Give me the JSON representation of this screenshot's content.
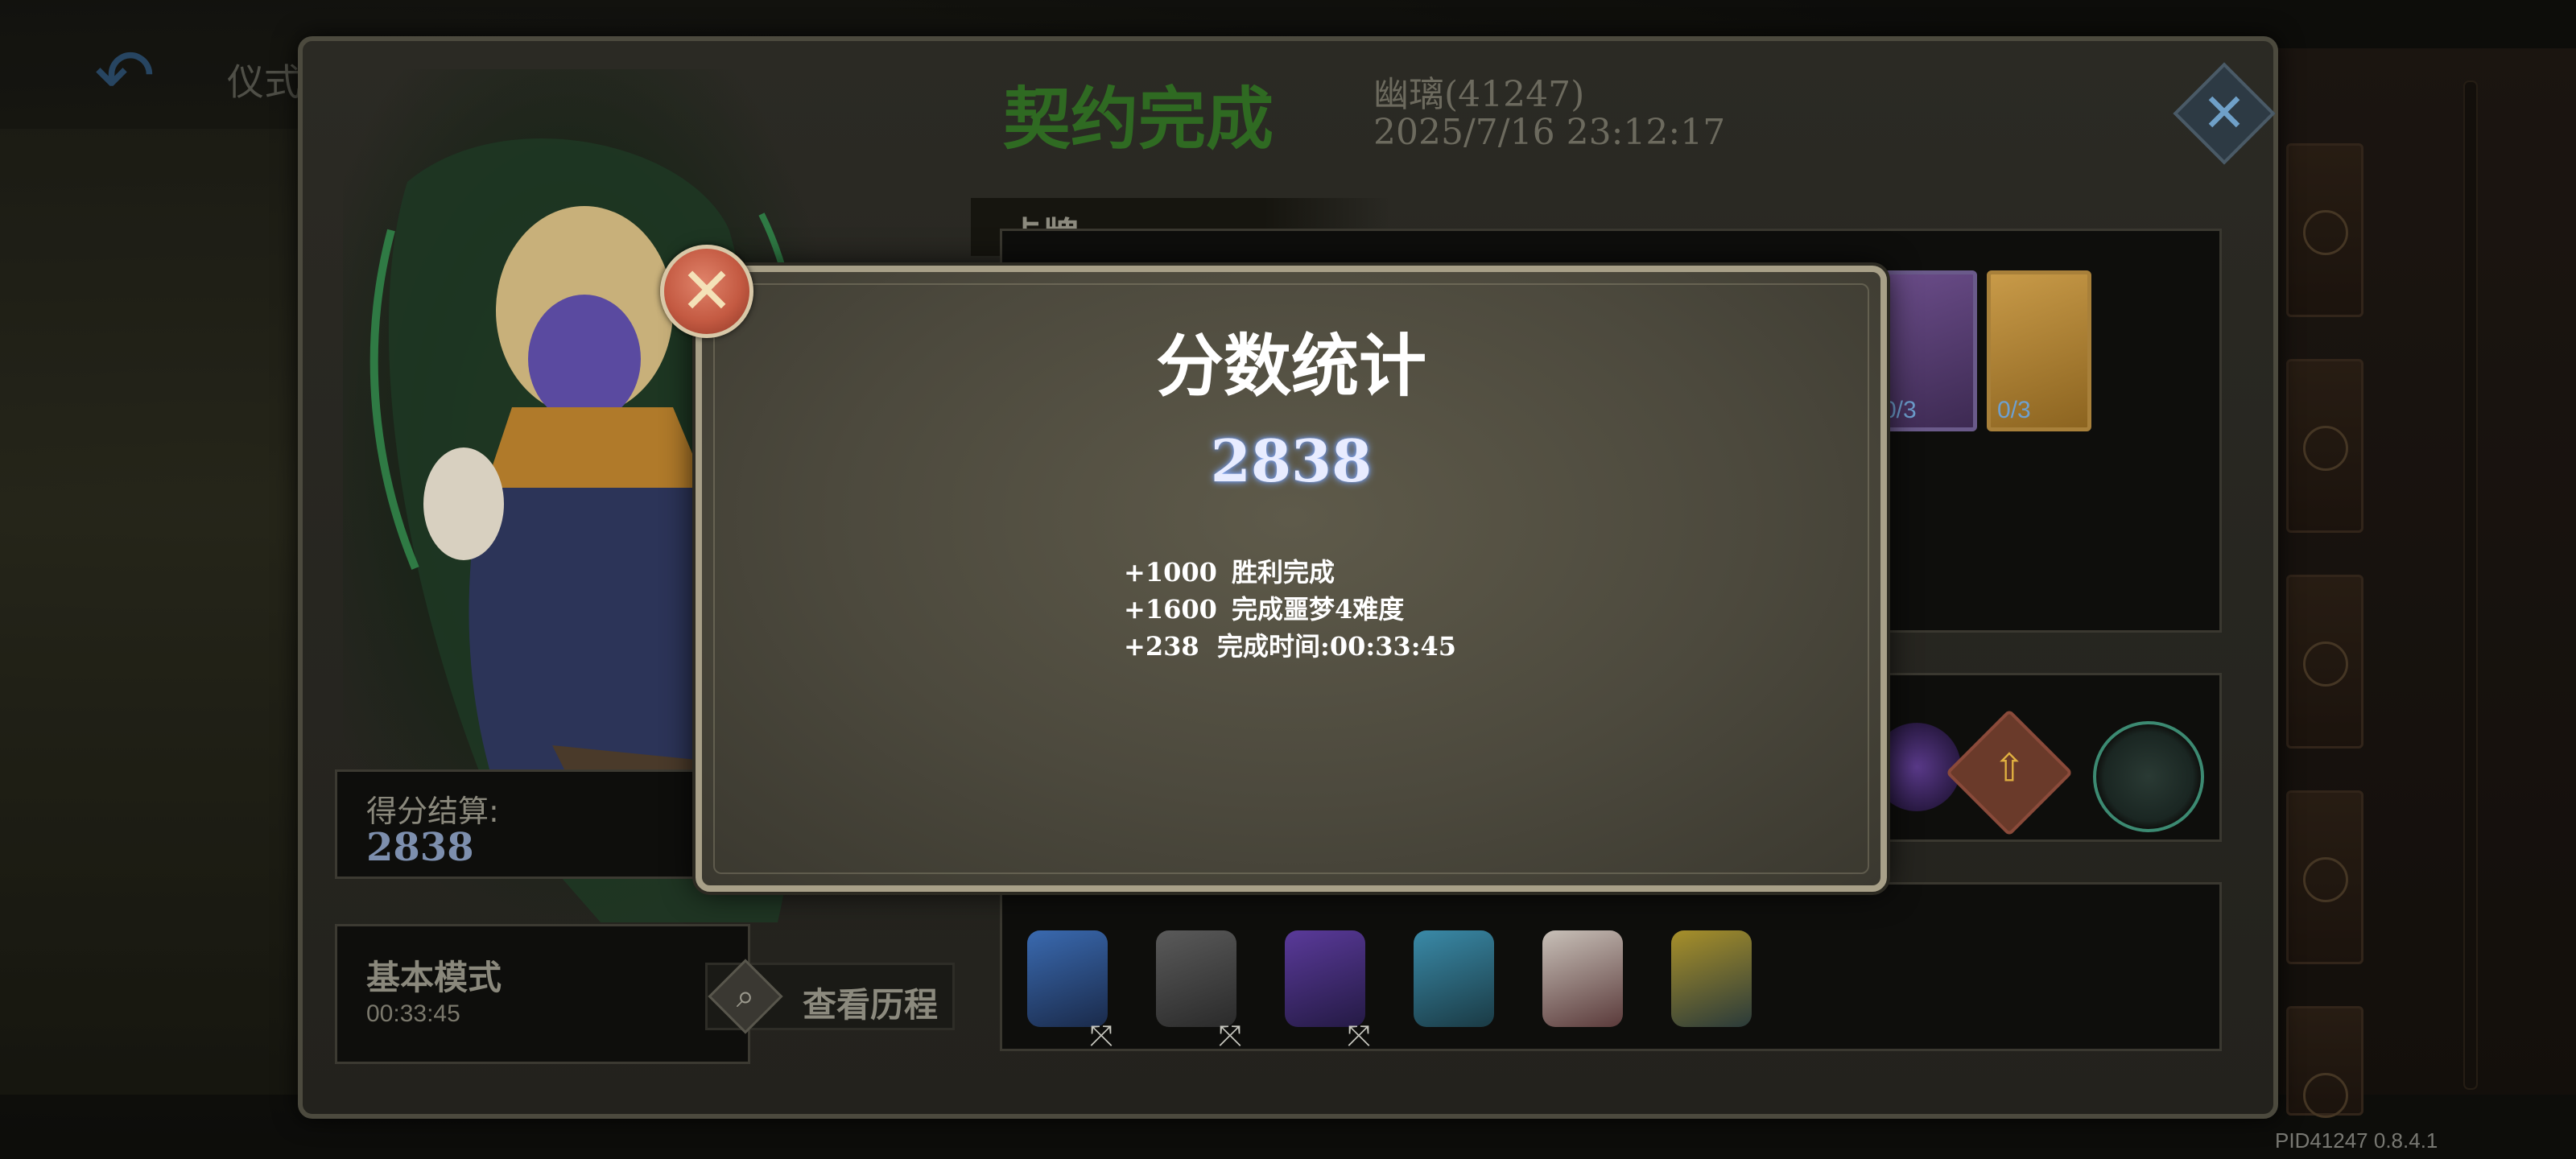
{
  "background": {
    "title": "仪式",
    "version": "PID41247  0.8.4.1"
  },
  "contract": {
    "title": "契约完成",
    "player_name": "幽璃(41247)",
    "timestamp": "2025/7/16 23:12:17",
    "score_label": "得分结算:",
    "score_value": "2838",
    "mode_label": "基本模式",
    "mode_time": "00:33:45",
    "history_button": "查看历程",
    "cards_header": "卡牌",
    "cards": [
      {
        "cost": "0/3",
        "color": "#6b4d8a"
      },
      {
        "cost": "0/3",
        "color": "#c89a48"
      }
    ],
    "icons": {
      "back": "back-arrow-icon",
      "close": "close-icon",
      "search": "magnifier-icon"
    }
  },
  "popup": {
    "title": "分数统计",
    "total": "2838",
    "breakdown": [
      {
        "points": "+1000",
        "label": "胜利完成"
      },
      {
        "points": "+1600",
        "label": "完成噩梦4难度"
      },
      {
        "points": "+238",
        "label": "完成时间:00:33:45"
      }
    ],
    "accent_color": "#c45a42"
  }
}
